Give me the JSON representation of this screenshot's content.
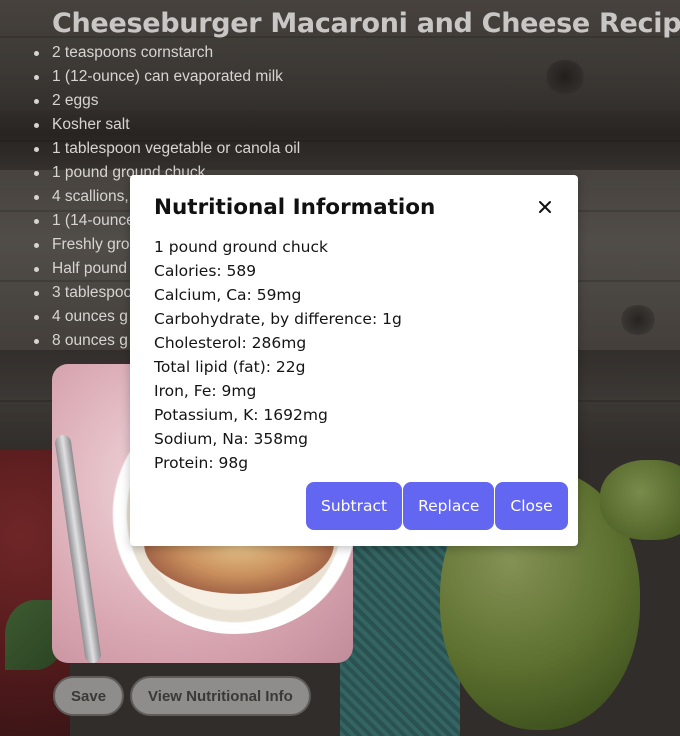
{
  "recipe": {
    "title": "Cheeseburger Macaroni and Cheese Recipe",
    "ingredients": [
      "2 teaspoons cornstarch",
      "1 (12-ounce) can evaporated milk",
      "2 eggs",
      "Kosher salt",
      "1 tablespoon vegetable or canola oil",
      "1 pound ground chuck",
      "4 scallions,",
      "1 (14-ounce",
      "Freshly gro",
      "Half pound",
      "3 tablespoo",
      "4 ounces g",
      "8 ounces g"
    ]
  },
  "actions": {
    "save_label": "Save",
    "nutrition_label": "View Nutritional Info"
  },
  "modal": {
    "title": "Nutritional Information",
    "close_icon": "close-icon",
    "items": [
      "1 pound ground chuck",
      "Calories: 589",
      "Calcium, Ca: 59mg",
      "Carbohydrate, by difference: 1g",
      "Cholesterol: 286mg",
      "Total lipid (fat): 22g",
      "Iron, Fe: 9mg",
      "Potassium, K: 1692mg",
      "Sodium, Na: 358mg",
      "Protein: 98g"
    ],
    "buttons": {
      "subtract": "Subtract",
      "replace": "Replace",
      "close": "Close"
    },
    "accent_color": "#6366f1"
  }
}
